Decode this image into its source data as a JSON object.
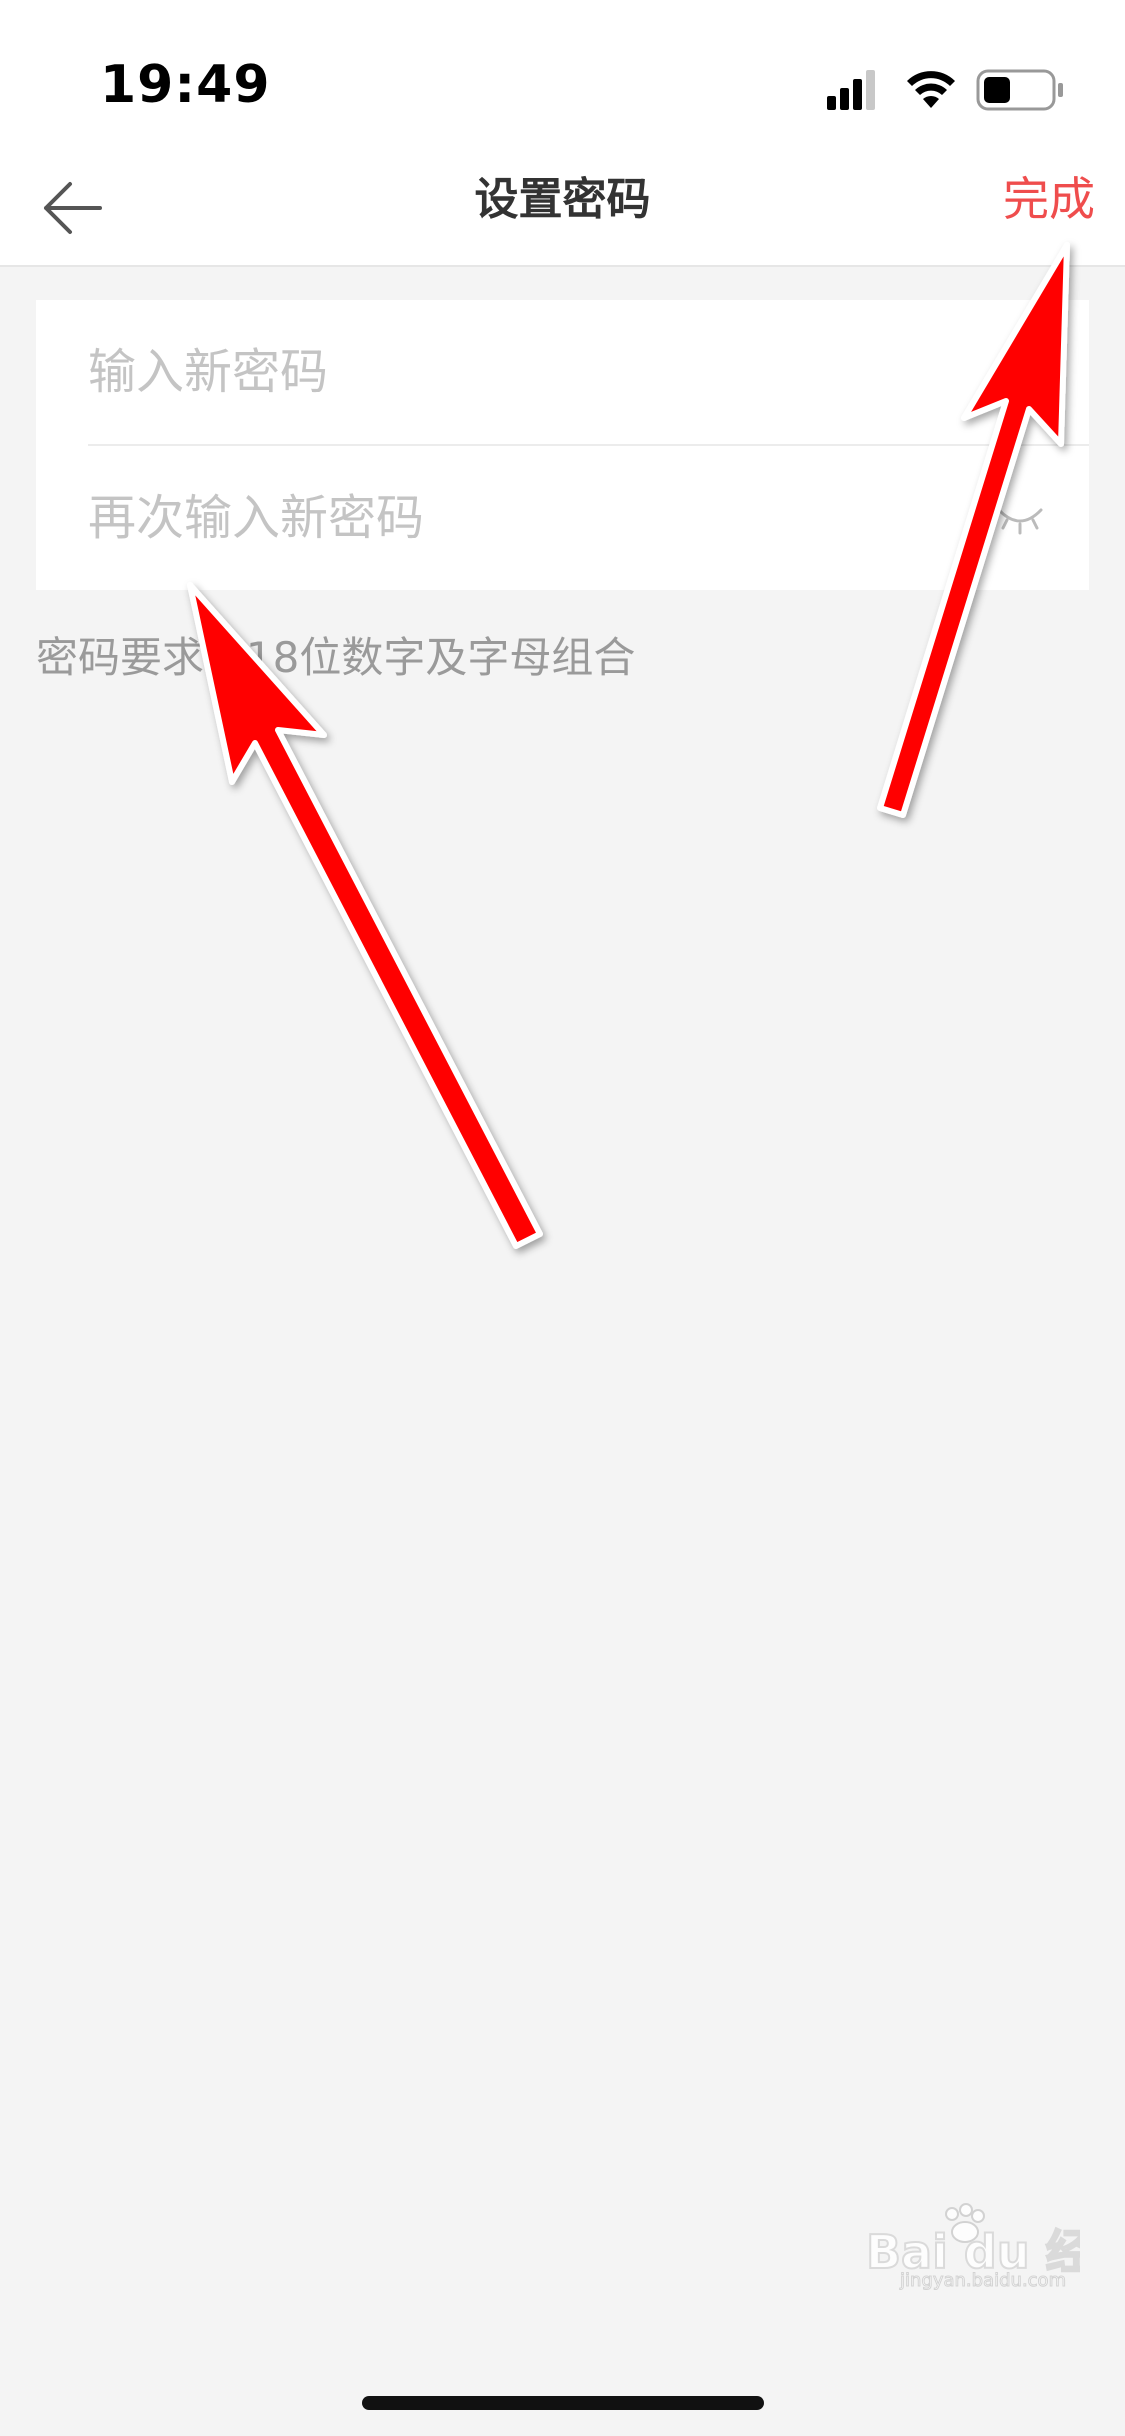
{
  "status_bar": {
    "time": "19:49"
  },
  "nav": {
    "title": "设置密码",
    "done_label": "完成"
  },
  "form": {
    "new_password_placeholder": "输入新密码",
    "confirm_password_placeholder": "再次输入新密码"
  },
  "hint": "密码要求6-18位数字及字母组合",
  "watermark": {
    "brand": "Bai du 经验",
    "sub": "jingyan.baidu.com"
  },
  "colors": {
    "accent": "#ef4d4d",
    "arrow": "#ff0000",
    "background": "#f4f4f4"
  },
  "icons": [
    "back-arrow-icon",
    "eye-icon",
    "signal-icon",
    "wifi-icon",
    "battery-icon",
    "annotation-arrow"
  ]
}
